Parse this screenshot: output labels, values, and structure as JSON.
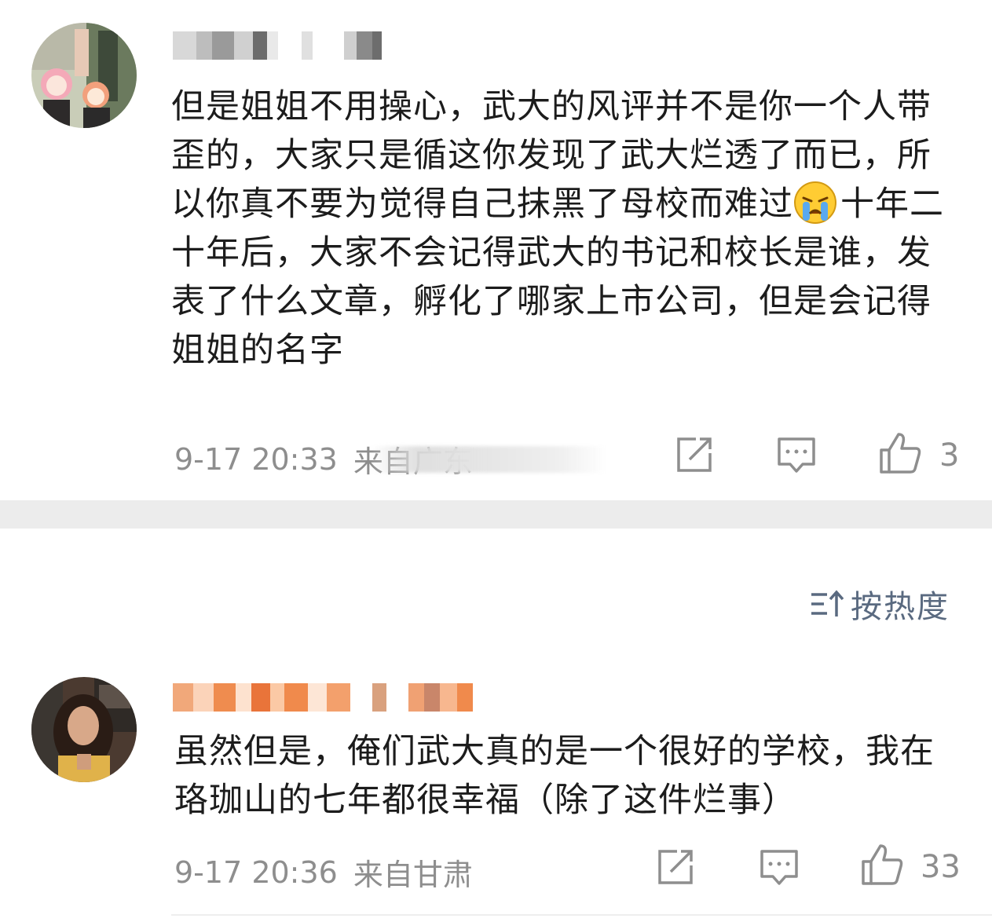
{
  "comments": [
    {
      "username": "",
      "text_before_emoji": "但是姐姐不用操心，武大的风评并不是你一个人带歪的，大家只是循这你发现了武大烂透了而已，所以你真不要为觉得自己抹黑了母校而难过",
      "emoji": "crying-face",
      "text_after_emoji": "十年二十年后，大家不会记得武大的书记和校长是谁，发表了什么文章，孵化了哪家上市公司，但是会记得姐姐的名字",
      "time": "9-17 20:33",
      "location": "来自广东",
      "likes": "3"
    },
    {
      "username": "",
      "text": "虽然但是，俺们武大真的是一个很好的学校，我在珞珈山的七年都很幸福（除了这件烂事）",
      "time": "9-17 20:36",
      "location": "来自甘肃",
      "likes": "33"
    }
  ],
  "sort": {
    "label": "按热度"
  },
  "icons": {
    "share": "share-edit-icon",
    "reply": "comment-bubble-icon",
    "like": "thumbs-up-icon",
    "sort": "sort-arrow-icon"
  },
  "colors": {
    "text": "#1c1c1c",
    "meta": "#8e8e8e",
    "sort": "#5a6a80",
    "divider": "#ececec"
  }
}
